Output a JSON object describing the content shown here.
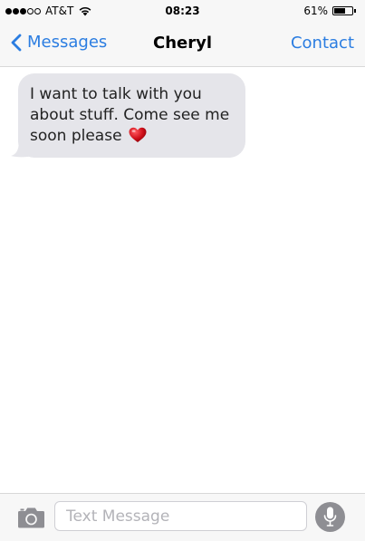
{
  "status_bar": {
    "signal_bars_filled": 3,
    "signal_bars_total": 5,
    "carrier": "AT&T",
    "time": "08:23",
    "battery_percent_text": "61%",
    "battery_level": 0.61,
    "wifi_icon": "wifi-icon"
  },
  "nav": {
    "back_label": "Messages",
    "title": "Cheryl",
    "right_label": "Contact"
  },
  "messages": [
    {
      "direction": "incoming",
      "text": "I want to talk with you about stuff. Come see me soon please",
      "emoji": "heart-icon"
    }
  ],
  "composer": {
    "placeholder": "Text Message",
    "value": "",
    "left_icon": "camera-icon",
    "right_icon": "microphone-icon"
  },
  "colors": {
    "accent": "#2b7de1",
    "bubble_incoming": "#e5e5ea",
    "bar_background": "#f7f7f7",
    "mic_button": "#8e8e93",
    "heart": "#d0101a"
  }
}
